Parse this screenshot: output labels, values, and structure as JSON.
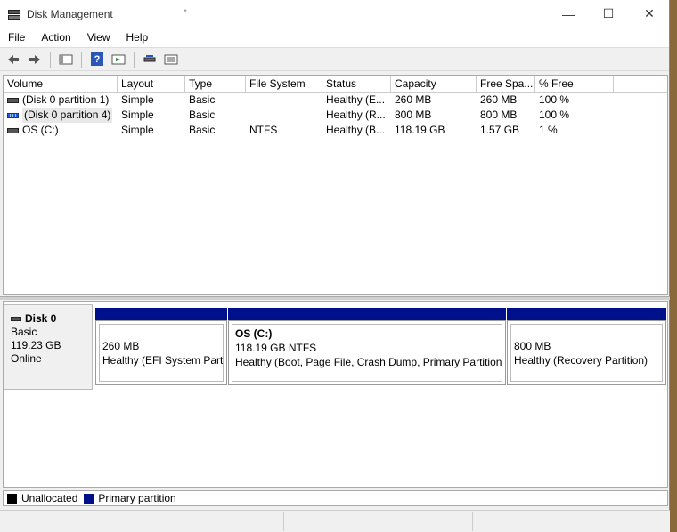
{
  "window": {
    "title": "Disk Management",
    "title_dot": "*",
    "minimize": "—",
    "maximize": "☐",
    "close": "✕"
  },
  "menu": [
    "File",
    "Action",
    "View",
    "Help"
  ],
  "toolbar": {
    "icons": [
      "back-arrow-icon",
      "forward-arrow-icon",
      "console-tree-icon",
      "help-icon",
      "properties-icon",
      "connect-disk-icon",
      "list-view-icon"
    ],
    "help_glyph": "?"
  },
  "columns": [
    "Volume",
    "Layout",
    "Type",
    "File System",
    "Status",
    "Capacity",
    "Free Spa...",
    "% Free"
  ],
  "volumes": [
    {
      "name": "(Disk 0 partition 1)",
      "layout": "Simple",
      "type": "Basic",
      "fs": "",
      "status": "Healthy (E...",
      "capacity": "260 MB",
      "free": "260 MB",
      "pct": "100 %"
    },
    {
      "name": "(Disk 0 partition 4)",
      "layout": "Simple",
      "type": "Basic",
      "fs": "",
      "status": "Healthy (R...",
      "capacity": "800 MB",
      "free": "800 MB",
      "pct": "100 %"
    },
    {
      "name": "OS (C:)",
      "layout": "Simple",
      "type": "Basic",
      "fs": "NTFS",
      "status": "Healthy (B...",
      "capacity": "118.19 GB",
      "free": "1.57 GB",
      "pct": "1 %"
    }
  ],
  "disk": {
    "name": "Disk 0",
    "kind": "Basic",
    "size": "119.23 GB",
    "state": "Online"
  },
  "partitions": [
    {
      "name": "",
      "size": "260 MB",
      "status": "Healthy (EFI System Partit"
    },
    {
      "name": "OS  (C:)",
      "size": "118.19 GB NTFS",
      "status": "Healthy (Boot, Page File, Crash Dump, Primary Partition)"
    },
    {
      "name": "",
      "size": "800 MB",
      "status": "Healthy (Recovery Partition)"
    }
  ],
  "legend": {
    "unallocated": "Unallocated",
    "primary": "Primary partition",
    "unallocated_color": "#000000",
    "primary_color": "#00108a"
  }
}
